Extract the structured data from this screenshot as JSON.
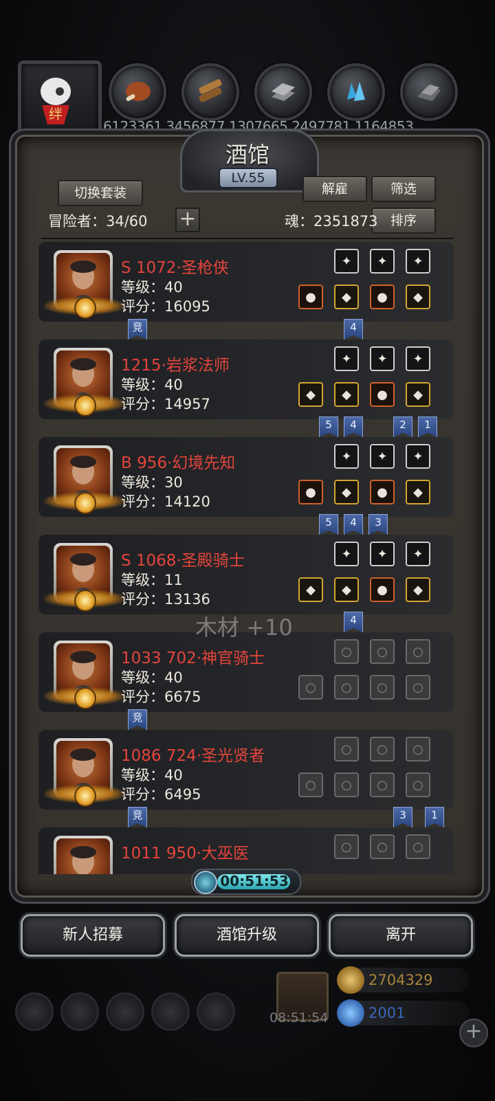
{
  "resources": {
    "values_text": "6123361 3456877 1307665 2497781 1164853",
    "icons": [
      "avatar-badge-icon",
      "meat-icon",
      "wood-icon",
      "iron-icon",
      "crystal-icon",
      "stone-icon"
    ]
  },
  "header": {
    "title": "酒馆",
    "level": "LV.55",
    "switch_set_label": "切换套装",
    "dismiss_label": "解雇",
    "filter_label": "筛选",
    "sort_label": "排序",
    "adventurers_text": "冒险者：34/60",
    "soul_text": "魂：2351873",
    "add_symbol": "+"
  },
  "heroes": [
    {
      "name": "S 1072·圣枪侠",
      "level": "等级：40",
      "score": "评分：16095",
      "gear_top": [
        "white",
        "white",
        "white"
      ],
      "gear_bottom": [
        "orange",
        "gold",
        "orange",
        "gold"
      ],
      "tags": [
        {
          "text": "竞",
          "col": "left"
        },
        {
          "text": "4",
          "col": 1
        }
      ]
    },
    {
      "name": "1215·岩浆法师",
      "level": "等级：40",
      "score": "评分：14957",
      "gear_top": [
        "white",
        "white",
        "white"
      ],
      "gear_bottom": [
        "gold",
        "gold",
        "orange",
        "gold"
      ],
      "tags": [
        {
          "text": "5",
          "col": 0
        },
        {
          "text": "4",
          "col": 1
        },
        {
          "text": "2",
          "col": 3
        },
        {
          "text": "1",
          "col": 4
        }
      ]
    },
    {
      "name": "B 956·幻境先知",
      "level": "等级：30",
      "score": "评分：14120",
      "gear_top": [
        "white",
        "white",
        "white"
      ],
      "gear_bottom": [
        "orange",
        "gold",
        "orange",
        "gold"
      ],
      "tags": [
        {
          "text": "5",
          "col": 0
        },
        {
          "text": "4",
          "col": 1
        },
        {
          "text": "3",
          "col": 2
        }
      ]
    },
    {
      "name": "S 1068·圣殿骑士",
      "level": "等级：11",
      "score": "评分：13136",
      "gear_top": [
        "white",
        "white",
        "white"
      ],
      "gear_bottom": [
        "gold",
        "gold",
        "orange",
        "gold"
      ],
      "tags": [
        {
          "text": "4",
          "col": 1
        }
      ]
    },
    {
      "name": "1033 702·神官骑士",
      "level": "等级：40",
      "score": "评分：6675",
      "gear_top": [
        "empty",
        "empty",
        "empty"
      ],
      "gear_bottom": [
        "empty",
        "empty",
        "empty",
        "empty"
      ],
      "tags": [
        {
          "text": "竞",
          "col": "left"
        }
      ]
    },
    {
      "name": "1086 724·圣光贤者",
      "level": "等级：40",
      "score": "评分：6495",
      "gear_top": [
        "empty",
        "empty",
        "empty"
      ],
      "gear_bottom": [
        "empty",
        "empty",
        "empty",
        "empty"
      ],
      "tags": [
        {
          "text": "竞",
          "col": "left"
        },
        {
          "text": "3",
          "col": 3
        },
        {
          "text": "1",
          "col": 5
        }
      ]
    },
    {
      "name": "1011 950·大巫医",
      "level": "",
      "score": "",
      "gear_top": [
        "empty",
        "empty",
        "empty"
      ],
      "gear_bottom": [],
      "tags": []
    }
  ],
  "floating_text": "木材 +10",
  "timer": "00:51:53",
  "buttons": {
    "recruit": "新人招募",
    "upgrade": "酒馆升级",
    "leave": "离开"
  },
  "bottom_hud": {
    "gift_timer": "08:51:54",
    "gold": "2704329",
    "gems": "2001",
    "add_symbol": "+"
  },
  "colors": {
    "hero_name": "#e4453c",
    "tag_blue": "#2b4680",
    "gold_currency": "#c9a24a",
    "gem_currency": "#4a7ac8"
  }
}
